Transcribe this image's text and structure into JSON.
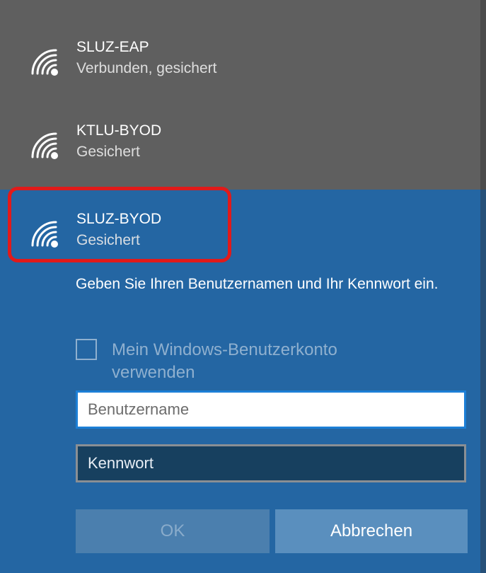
{
  "networks": [
    {
      "name": "SLUZ-EAP",
      "status": "Verbunden, gesichert",
      "icon": "wifi-secured-icon"
    },
    {
      "name": "KTLU-BYOD",
      "status": "Gesichert",
      "icon": "wifi-secured-icon"
    },
    {
      "name": "SLUZ-BYOD",
      "status": "Gesichert",
      "icon": "wifi-secured-icon",
      "selected": true
    }
  ],
  "login": {
    "prompt": "Geben Sie Ihren Benutzernamen und Ihr Kennwort ein.",
    "use_windows_account_label": "Mein Windows-Benutzerkonto verwenden",
    "use_windows_account_checked": false,
    "username_placeholder": "Benutzername",
    "username_value": "",
    "password_placeholder": "Kennwort",
    "password_value": ""
  },
  "buttons": {
    "ok_label": "OK",
    "cancel_label": "Abbrechen"
  },
  "colors": {
    "list_background": "#5f5f5f",
    "selected_background": "#2466a3",
    "highlight_border": "#e11a1a",
    "input_focus_border": "#1c7fd6"
  }
}
